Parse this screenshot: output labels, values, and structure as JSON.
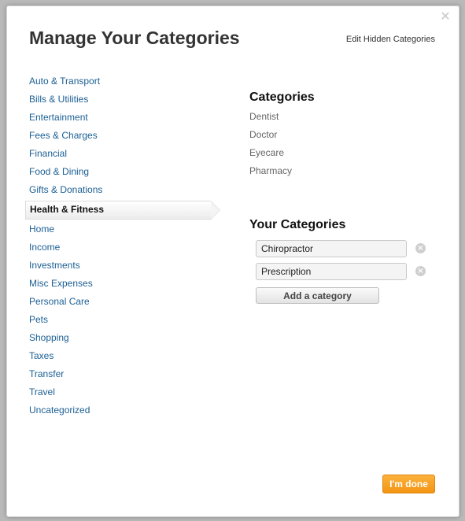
{
  "dialog": {
    "title": "Manage Your Categories",
    "edit_hidden_label": "Edit Hidden Categories",
    "close_glyph": "✕"
  },
  "category_list": [
    {
      "label": "Auto & Transport",
      "selected": false
    },
    {
      "label": "Bills & Utilities",
      "selected": false
    },
    {
      "label": "Entertainment",
      "selected": false
    },
    {
      "label": "Fees & Charges",
      "selected": false
    },
    {
      "label": "Financial",
      "selected": false
    },
    {
      "label": "Food & Dining",
      "selected": false
    },
    {
      "label": "Gifts & Donations",
      "selected": false
    },
    {
      "label": "Health & Fitness",
      "selected": true
    },
    {
      "label": "Home",
      "selected": false
    },
    {
      "label": "Income",
      "selected": false
    },
    {
      "label": "Investments",
      "selected": false
    },
    {
      "label": "Misc Expenses",
      "selected": false
    },
    {
      "label": "Personal Care",
      "selected": false
    },
    {
      "label": "Pets",
      "selected": false
    },
    {
      "label": "Shopping",
      "selected": false
    },
    {
      "label": "Taxes",
      "selected": false
    },
    {
      "label": "Transfer",
      "selected": false
    },
    {
      "label": "Travel",
      "selected": false
    },
    {
      "label": "Uncategorized",
      "selected": false
    }
  ],
  "categories_section": {
    "title": "Categories",
    "items": [
      "Dentist",
      "Doctor",
      "Eyecare",
      "Pharmacy"
    ]
  },
  "your_categories_section": {
    "title": "Your Categories",
    "items": [
      {
        "value": "Chiropractor"
      },
      {
        "value": "Prescription"
      }
    ],
    "add_label": "Add a category"
  },
  "footer": {
    "done_label": "I'm done"
  },
  "colors": {
    "link": "#1b5f93",
    "accent": "#f39412"
  }
}
